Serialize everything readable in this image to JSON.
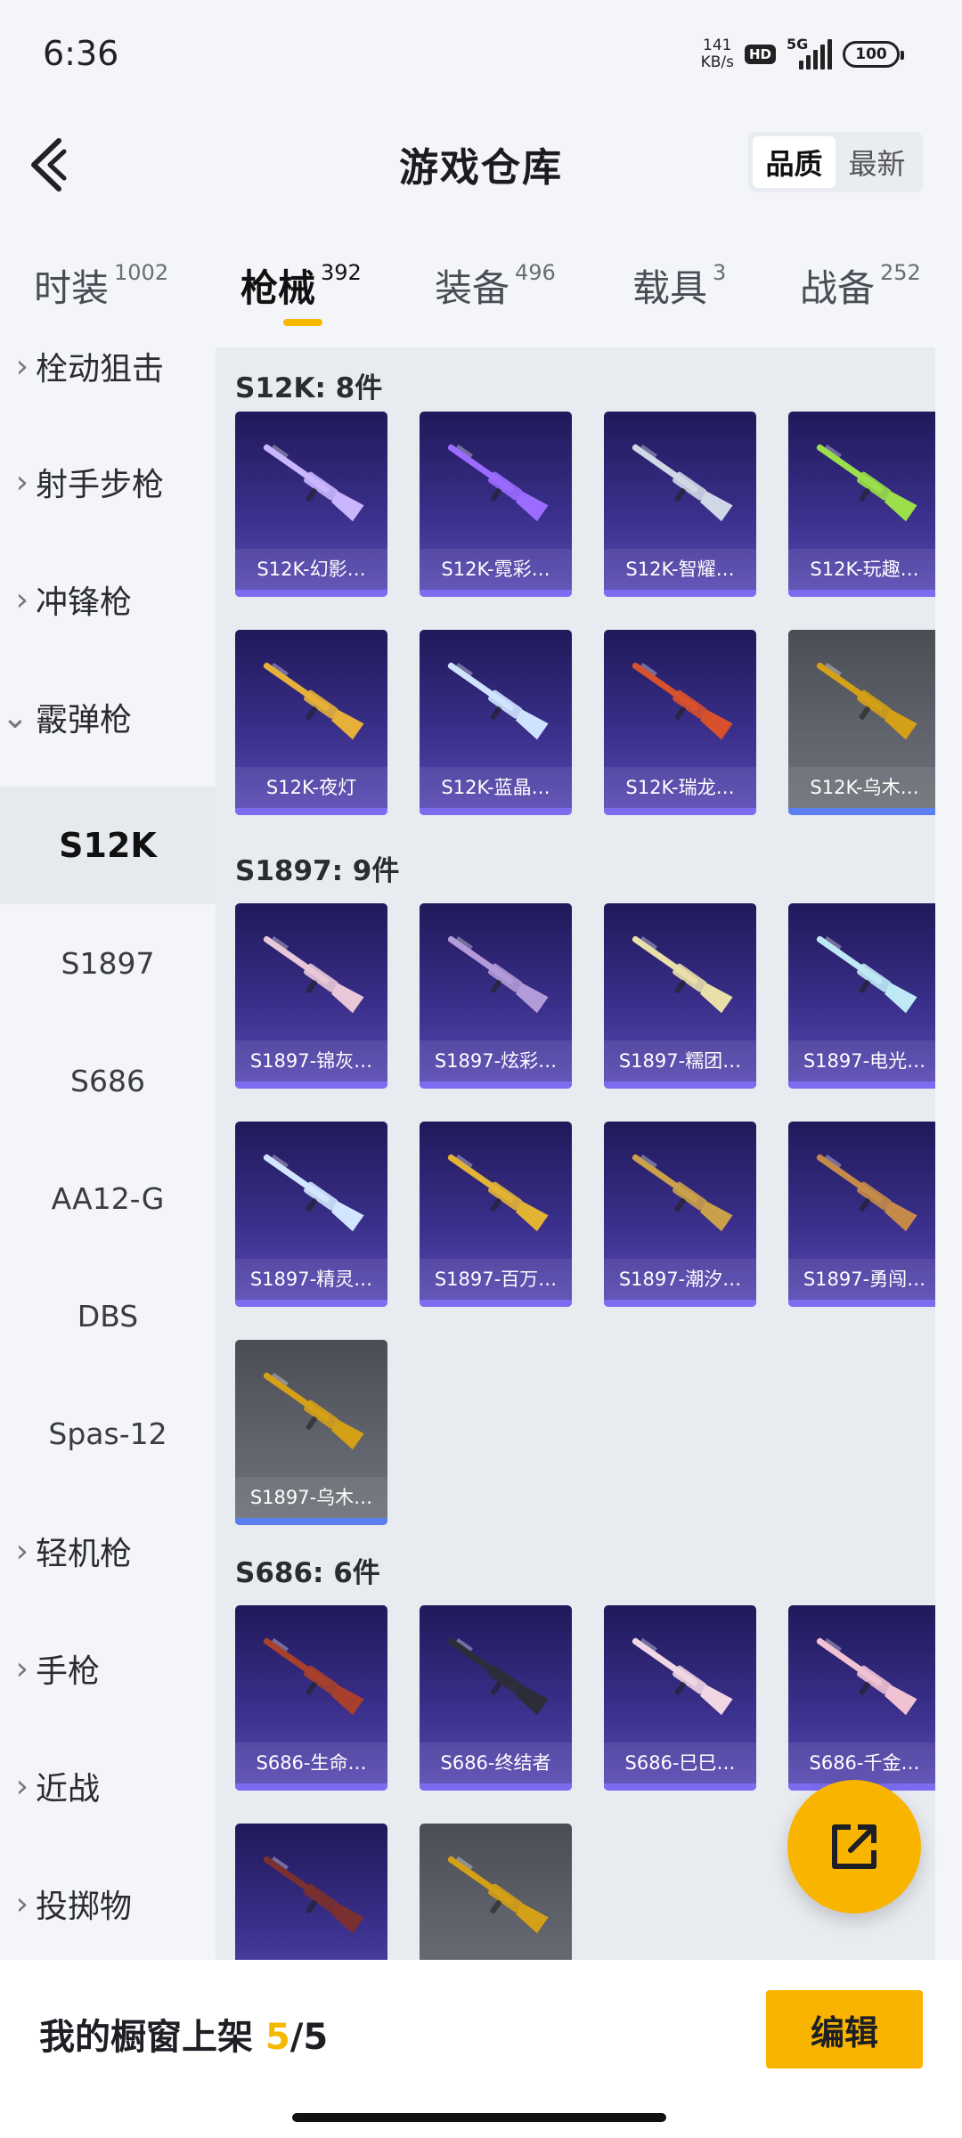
{
  "status": {
    "time": "6:36",
    "net_speed": "141",
    "net_unit": "KB/s",
    "hd": "HD",
    "network": "5G",
    "battery": "100"
  },
  "header": {
    "title": "游戏仓库",
    "sort_options": [
      "品质",
      "最新"
    ],
    "sort_active": "品质"
  },
  "tabs": [
    {
      "label": "时装",
      "count": "1002"
    },
    {
      "label": "枪械",
      "count": "392"
    },
    {
      "label": "装备",
      "count": "496"
    },
    {
      "label": "载具",
      "count": "3"
    },
    {
      "label": "战备",
      "count": "252"
    }
  ],
  "sidebar": {
    "categories_top": [
      "栓动狙击",
      "射手步枪",
      "冲锋枪",
      "霰弹枪"
    ],
    "subitems": [
      "S12K",
      "S1897",
      "S686",
      "AA12-G",
      "DBS",
      "Spas-12"
    ],
    "categories_bottom": [
      "轻机枪",
      "手枪",
      "近战",
      "投掷物"
    ]
  },
  "sections": [
    {
      "title": "S12K: 8件",
      "items": [
        {
          "name": "S12K-幻影…",
          "color": "#c9b6ff"
        },
        {
          "name": "S12K-霓彩…",
          "color": "#9b6cff"
        },
        {
          "name": "S12K-智耀…",
          "color": "#cfd8e6"
        },
        {
          "name": "S12K-玩趣…",
          "color": "#9be04a"
        },
        {
          "name": "S12K-夜灯",
          "color": "#e6b03a"
        },
        {
          "name": "S12K-蓝晶…",
          "color": "#cfe3ff"
        },
        {
          "name": "S12K-瑞龙…",
          "color": "#d8512c"
        },
        {
          "name": "S12K-乌木…",
          "color": "#d4a017",
          "grey": true
        }
      ]
    },
    {
      "title": "S1897: 9件",
      "items": [
        {
          "name": "S1897-锦灰…",
          "color": "#e8c7d8"
        },
        {
          "name": "S1897-炫彩…",
          "color": "#b39ad8"
        },
        {
          "name": "S1897-糯团…",
          "color": "#e9dfa8"
        },
        {
          "name": "S1897-电光…",
          "color": "#bfeaf5"
        },
        {
          "name": "S1897-精灵…",
          "color": "#d2e7ff"
        },
        {
          "name": "S1897-百万…",
          "color": "#e2b335"
        },
        {
          "name": "S1897-潮汐…",
          "color": "#caa04a"
        },
        {
          "name": "S1897-勇闯…",
          "color": "#c58a4a"
        },
        {
          "name": "S1897-乌木…",
          "color": "#d4a017",
          "grey": true
        }
      ]
    },
    {
      "title": "S686: 6件",
      "items": [
        {
          "name": "S686-生命…",
          "color": "#a8402c"
        },
        {
          "name": "S686-终结者",
          "color": "#2d2d3a"
        },
        {
          "name": "S686-巳巳…",
          "color": "#f1d6e3"
        },
        {
          "name": "S686-千金…",
          "color": "#f0c2d4"
        },
        {
          "name": "",
          "color": "#7a3030"
        },
        {
          "name": "",
          "color": "#d4a017",
          "grey": true
        }
      ]
    }
  ],
  "bottom": {
    "showcase_label": "我的橱窗上架",
    "current": "5",
    "total": "/5",
    "edit_label": "编辑"
  },
  "accent_color": "#f9b400"
}
